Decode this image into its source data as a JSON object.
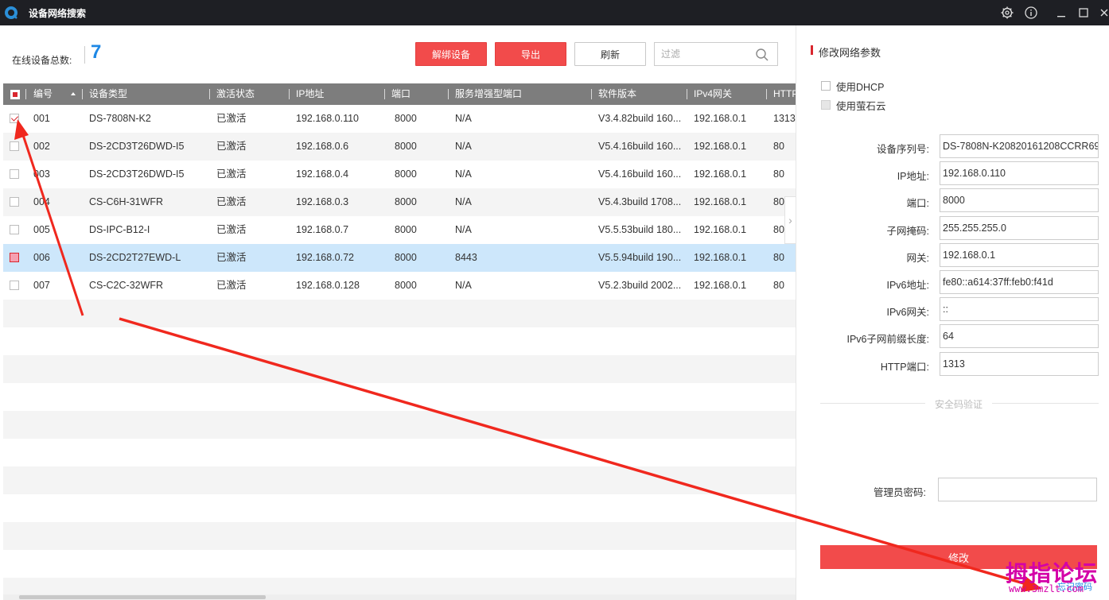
{
  "window": {
    "title": "设备网络搜索",
    "controls": [
      "gear-icon",
      "info-icon",
      "minimize-icon",
      "maximize-icon",
      "close-icon"
    ]
  },
  "toolbar": {
    "online_label": "在线设备总数:",
    "online_count": "7",
    "unbind_label": "解绑设备",
    "export_label": "导出",
    "refresh_label": "刷新",
    "filter_placeholder": "过滤"
  },
  "table": {
    "columns": [
      "编号",
      "设备类型",
      "激活状态",
      "IP地址",
      "端口",
      "服务增强型端口",
      "软件版本",
      "IPv4网关",
      "HTTP"
    ],
    "rows": [
      {
        "id": "001",
        "type": "DS-7808N-K2",
        "status": "已激活",
        "ip": "192.168.0.110",
        "port": "8000",
        "enh_port": "N/A",
        "version": "V3.4.82build 160...",
        "gateway": "192.168.0.1",
        "http": "1313",
        "checked": true
      },
      {
        "id": "002",
        "type": "DS-2CD3T26DWD-I5",
        "status": "已激活",
        "ip": "192.168.0.6",
        "port": "8000",
        "enh_port": "N/A",
        "version": "V5.4.16build 160...",
        "gateway": "192.168.0.1",
        "http": "80",
        "checked": false
      },
      {
        "id": "003",
        "type": "DS-2CD3T26DWD-I5",
        "status": "已激活",
        "ip": "192.168.0.4",
        "port": "8000",
        "enh_port": "N/A",
        "version": "V5.4.16build 160...",
        "gateway": "192.168.0.1",
        "http": "80",
        "checked": false
      },
      {
        "id": "004",
        "type": "CS-C6H-31WFR",
        "status": "已激活",
        "ip": "192.168.0.3",
        "port": "8000",
        "enh_port": "N/A",
        "version": "V5.4.3build 1708...",
        "gateway": "192.168.0.1",
        "http": "80",
        "checked": false
      },
      {
        "id": "005",
        "type": "DS-IPC-B12-I",
        "status": "已激活",
        "ip": "192.168.0.7",
        "port": "8000",
        "enh_port": "N/A",
        "version": "V5.5.53build 180...",
        "gateway": "192.168.0.1",
        "http": "80",
        "checked": false
      },
      {
        "id": "006",
        "type": "DS-2CD2T27EWD-L",
        "status": "已激活",
        "ip": "192.168.0.72",
        "port": "8000",
        "enh_port": "8443",
        "version": "V5.5.94build 190...",
        "gateway": "192.168.0.1",
        "http": "80",
        "checked": false,
        "selected": true
      },
      {
        "id": "007",
        "type": "CS-C2C-32WFR",
        "status": "已激活",
        "ip": "192.168.0.128",
        "port": "8000",
        "enh_port": "N/A",
        "version": "V5.2.3build 2002...",
        "gateway": "192.168.0.1",
        "http": "80",
        "checked": false
      }
    ]
  },
  "panel": {
    "title": "修改网络参数",
    "use_dhcp": "使用DHCP",
    "use_ezviz": "使用萤石云",
    "fields": [
      {
        "label": "设备序列号:",
        "value": "DS-7808N-K20820161208CCRR69"
      },
      {
        "label": "IP地址:",
        "value": "192.168.0.110"
      },
      {
        "label": "端口:",
        "value": "8000"
      },
      {
        "label": "子网掩码:",
        "value": "255.255.255.0"
      },
      {
        "label": "网关:",
        "value": "192.168.0.1"
      },
      {
        "label": "IPv6地址:",
        "value": "fe80::a614:37ff:feb0:f41d"
      },
      {
        "label": "IPv6网关:",
        "value": "::"
      },
      {
        "label": "IPv6子网前缀长度:",
        "value": "64"
      },
      {
        "label": "HTTP端口:",
        "value": "1313"
      }
    ],
    "security_label": "安全码验证",
    "password_label": "管理员密码:",
    "password_value": "",
    "modify_label": "修改",
    "forgot_label": "忘记密码"
  },
  "overlay": {
    "watermark": "拇指论坛",
    "watermark_sub": "www.3mzlt.com",
    "arrow_color": "#f0281e"
  }
}
